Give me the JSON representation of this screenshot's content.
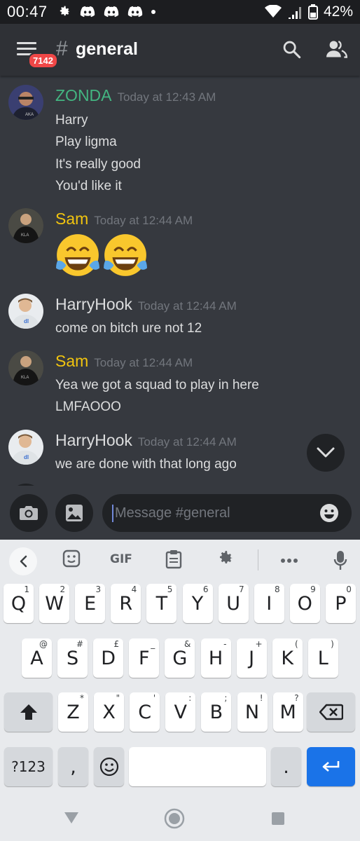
{
  "status": {
    "time": "00:47",
    "battery": "42%"
  },
  "header": {
    "badge": "7142",
    "hash": "#",
    "channel": "general"
  },
  "messages": [
    {
      "user": "ZONDA",
      "color": "#43b581",
      "time": "Today at 12:43 AM",
      "lines": [
        "Harry",
        "Play ligma",
        "It's really good",
        "You'd like it"
      ]
    },
    {
      "user": "Sam",
      "color": "#f1c40f",
      "time": "Today at 12:44 AM",
      "emoji": [
        "😂",
        "😂"
      ]
    },
    {
      "user": "HarryHook",
      "color": "#dcddde",
      "time": "Today at 12:44 AM",
      "lines": [
        "come on bitch ure not 12"
      ]
    },
    {
      "user": "Sam",
      "color": "#f1c40f",
      "time": "Today at 12:44 AM",
      "lines": [
        "Yea we got a squad to play in here",
        "LMFAOOO"
      ]
    },
    {
      "user": "HarryHook",
      "color": "#dcddde",
      "time": "Today at 12:44 AM",
      "lines": [
        "we are done with that long ago"
      ]
    }
  ],
  "input": {
    "placeholder": "Message #general"
  },
  "keyboard": {
    "toolbar": {
      "gif": "GIF"
    },
    "row1": [
      {
        "k": "Q",
        "h": "1"
      },
      {
        "k": "W",
        "h": "2"
      },
      {
        "k": "E",
        "h": "3"
      },
      {
        "k": "R",
        "h": "4"
      },
      {
        "k": "T",
        "h": "5"
      },
      {
        "k": "Y",
        "h": "6"
      },
      {
        "k": "U",
        "h": "7"
      },
      {
        "k": "I",
        "h": "8"
      },
      {
        "k": "O",
        "h": "9"
      },
      {
        "k": "P",
        "h": "0"
      }
    ],
    "row2": [
      {
        "k": "A",
        "h": "@"
      },
      {
        "k": "S",
        "h": "#"
      },
      {
        "k": "D",
        "h": "£"
      },
      {
        "k": "F",
        "h": "_"
      },
      {
        "k": "G",
        "h": "&"
      },
      {
        "k": "H",
        "h": "-"
      },
      {
        "k": "J",
        "h": "+"
      },
      {
        "k": "K",
        "h": "("
      },
      {
        "k": "L",
        "h": ")"
      }
    ],
    "row3": [
      {
        "k": "Z",
        "h": "*"
      },
      {
        "k": "X",
        "h": "\""
      },
      {
        "k": "C",
        "h": "'"
      },
      {
        "k": "V",
        "h": ":"
      },
      {
        "k": "B",
        "h": ";"
      },
      {
        "k": "N",
        "h": "!"
      },
      {
        "k": "M",
        "h": "?"
      }
    ],
    "symbols": "?123",
    "comma": ",",
    "period": "."
  },
  "colors": {
    "background": "#36393f",
    "header": "#2f3136",
    "accent": "#7289da",
    "enter": "#1a73e8"
  }
}
